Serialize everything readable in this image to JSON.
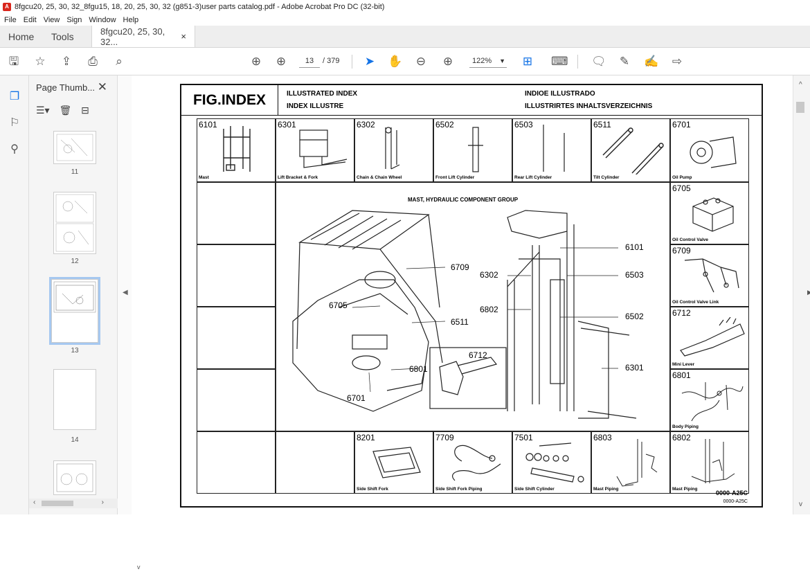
{
  "window": {
    "title": "8fgcu20, 25, 30, 32_8fgu15, 18, 20, 25, 30, 32 (g851-3)user parts catalog.pdf - Adobe Acrobat Pro DC (32-bit)",
    "app_icon": "acrobat-icon"
  },
  "menu": [
    "File",
    "Edit",
    "View",
    "Sign",
    "Window",
    "Help"
  ],
  "tabs": {
    "home": "Home",
    "tools": "Tools",
    "doc": "8fgcu20, 25, 30, 32...",
    "close": "×"
  },
  "toolbar": {
    "page_current": "13",
    "page_total": "/ 379",
    "zoom": "122%"
  },
  "thumbnails": {
    "title": "Page Thumb...",
    "close": "✕",
    "labels": [
      "11",
      "12",
      "13",
      "14"
    ],
    "selected": "13"
  },
  "page": {
    "fig": "FIG.INDEX",
    "header": {
      "l1": "ILLUSTRATED INDEX",
      "l2": "INDEX ILLUSTRE",
      "r1": "INDIOE ILLUSTRADO",
      "r2": "ILLUSTRIRTES INHALTSVERZEICHNIS"
    },
    "top_row": [
      {
        "num": "6101",
        "cap": "Mast"
      },
      {
        "num": "6301",
        "cap": "Lift Bracket & Fork"
      },
      {
        "num": "6302",
        "cap": "Chain & Chain Wheel"
      },
      {
        "num": "6502",
        "cap": "Front Lift Cylinder"
      },
      {
        "num": "6503",
        "cap": "Rear Lift Cylinder"
      },
      {
        "num": "6511",
        "cap": "Tilt Cylinder"
      },
      {
        "num": "6701",
        "cap": "Oil Pump"
      }
    ],
    "right_col": [
      {
        "num": "6705",
        "cap": "Oil Control Valve"
      },
      {
        "num": "6709",
        "cap": "Oil Control Valve Link"
      },
      {
        "num": "6712",
        "cap": "Mini Lever"
      },
      {
        "num": "6801",
        "cap": "Body Piping"
      }
    ],
    "bottom_row": [
      {
        "num": "8201",
        "cap": "Side Shift Fork"
      },
      {
        "num": "7709",
        "cap": "Side Shift Fork Piping"
      },
      {
        "num": "7501",
        "cap": "Side Shift Cylinder"
      },
      {
        "num": "6803",
        "cap": "Mast Piping"
      },
      {
        "num": "6802",
        "cap": "Mast Piping"
      }
    ],
    "group_title": "MAST, HYDRAULIC COMPONENT GROUP",
    "callouts": {
      "c6709": "6709",
      "c6705": "6705",
      "c6511": "6511",
      "c6801": "6801",
      "c6701": "6701",
      "c6712": "6712",
      "c6302": "6302",
      "c6802": "6802",
      "c6101": "6101",
      "c6503": "6503",
      "c6502": "6502",
      "c6301": "6301"
    },
    "footer1": "0000-A25C",
    "footer2": "0000-A25C"
  }
}
